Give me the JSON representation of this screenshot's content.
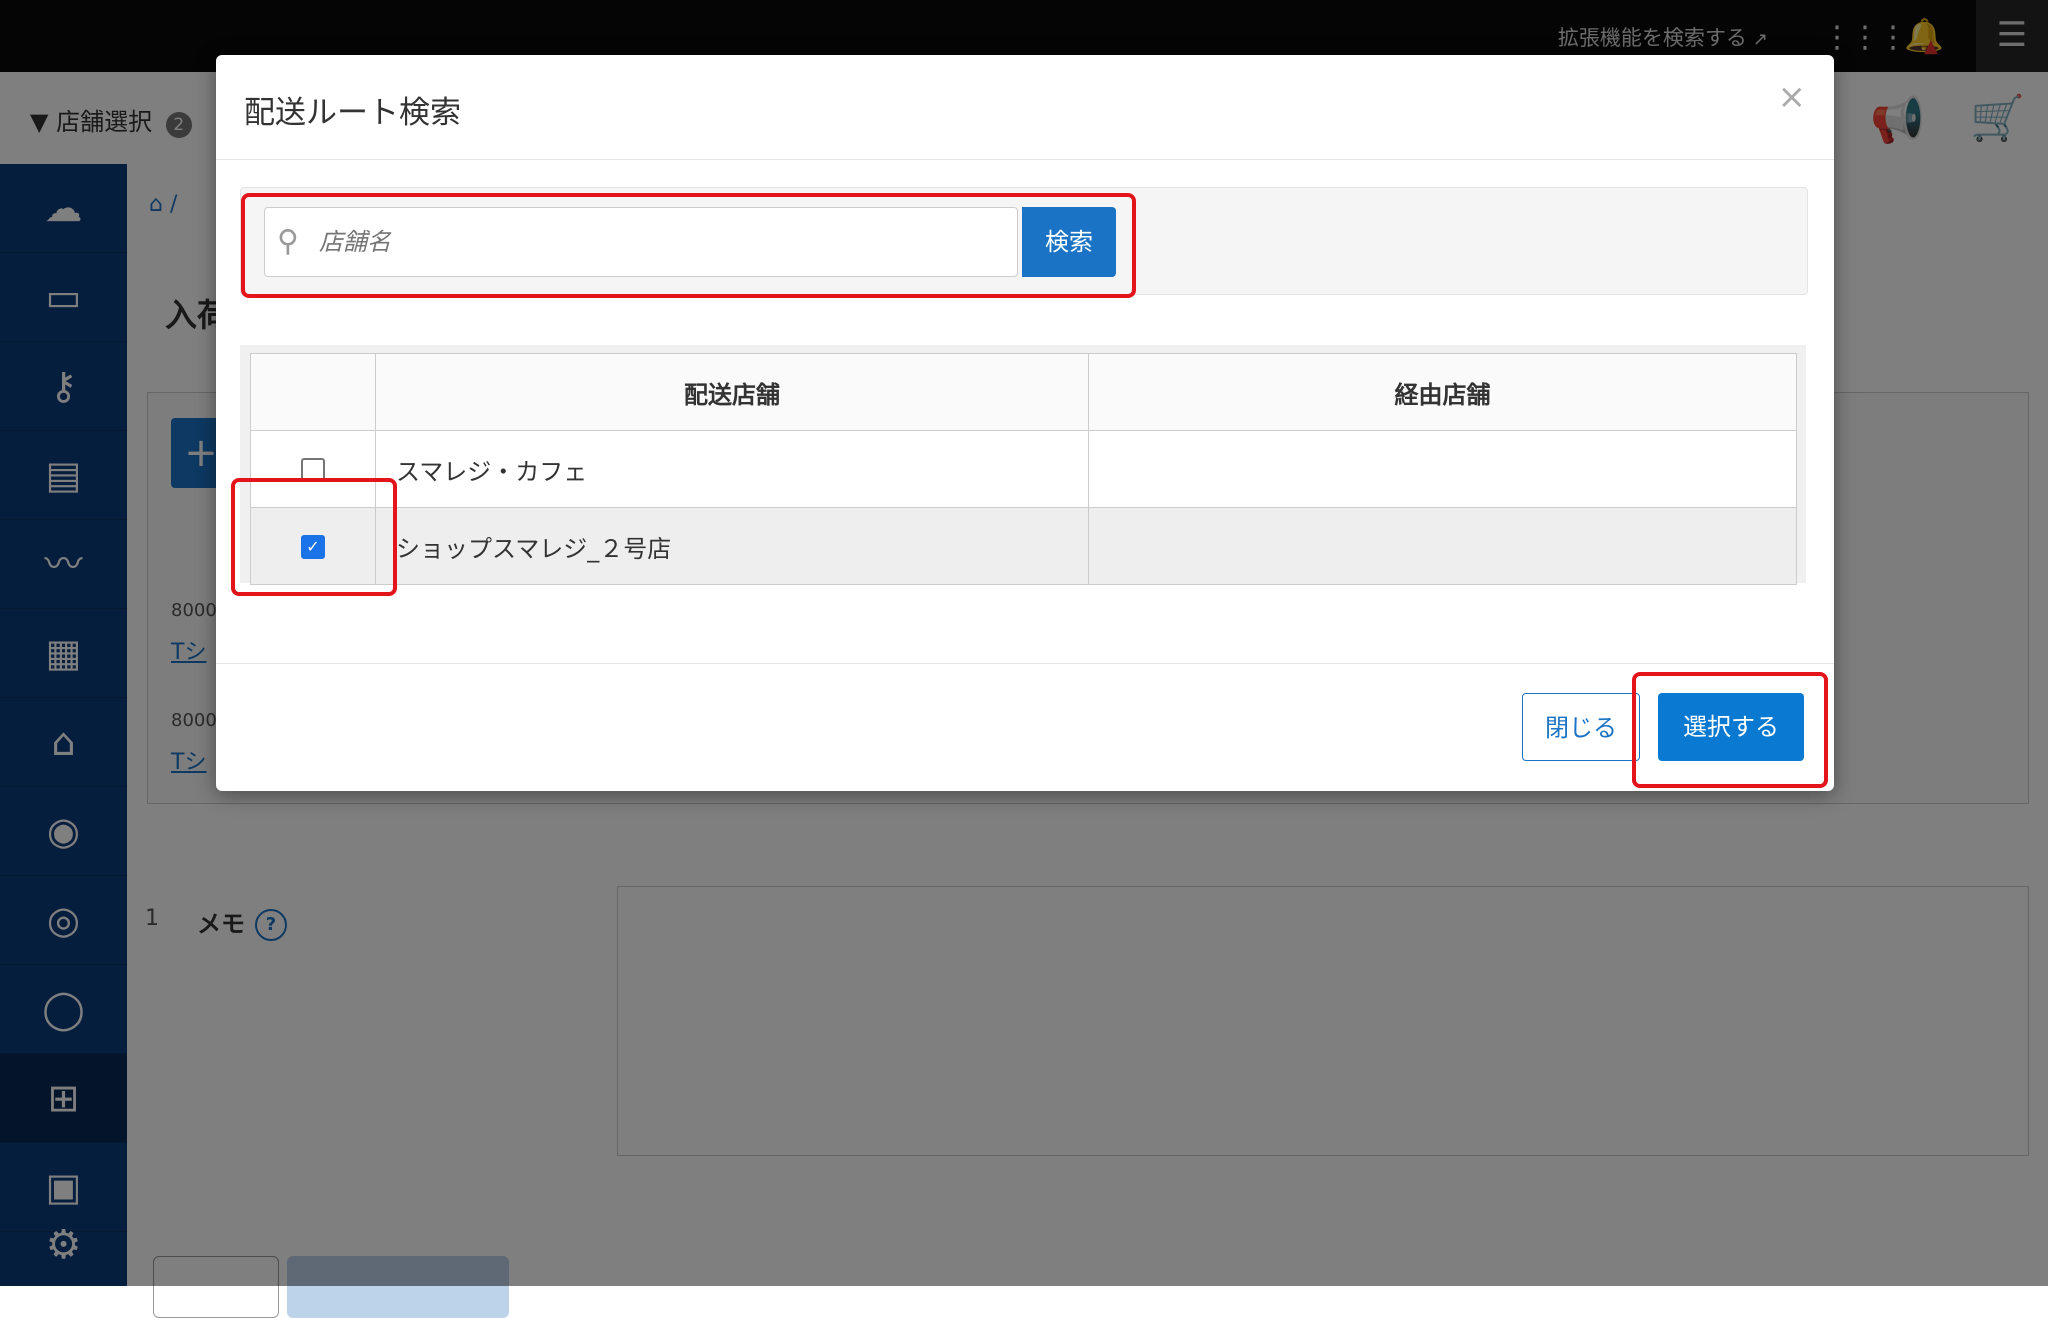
{
  "topbar": {
    "ext_search_label": "拡張機能を検索する",
    "ext_icon": "external-link-icon",
    "apps_icon": "grid-icon",
    "bell_icon": "bell-icon",
    "menu_icon": "hamburger-icon"
  },
  "subbar": {
    "store_select_label": "店舗選択",
    "store_select_count": "2",
    "caret": "▼",
    "announce_icon": "megaphone-icon",
    "cart_icon": "cart-icon"
  },
  "sidebar": {
    "items": [
      "cloud-icon",
      "archive-icon",
      "key-icon",
      "book-icon",
      "chart-icon",
      "report-icon",
      "store-icon",
      "user-icon",
      "target-icon",
      "profile-icon",
      "grid-layout-icon",
      "clipboard-icon"
    ],
    "settings_icon": "gear-icon"
  },
  "content": {
    "breadcrumb_sep": "/",
    "title": "入荷",
    "rows": [
      {
        "code": "8000",
        "link": "Tシ"
      },
      {
        "code": "8000",
        "link": "Tシ"
      }
    ],
    "memo_number": "1",
    "memo_label": "メモ",
    "help": "?"
  },
  "modal": {
    "title": "配送ルート検索",
    "close": "×",
    "search": {
      "placeholder": "店舗名",
      "button_label": "検索"
    },
    "table": {
      "headers": [
        "配送店舗",
        "経由店舗"
      ],
      "rows": [
        {
          "checked": false,
          "delivery_store": "スマレジ・カフェ",
          "via_store": ""
        },
        {
          "checked": true,
          "delivery_store": "ショップスマレジ_２号店",
          "via_store": ""
        }
      ]
    },
    "close_button": "閉じる",
    "select_button": "選択する"
  },
  "colors": {
    "accent": "#0a79d1",
    "highlight": "#e4141b",
    "sidebar": "#0d3d7a"
  }
}
